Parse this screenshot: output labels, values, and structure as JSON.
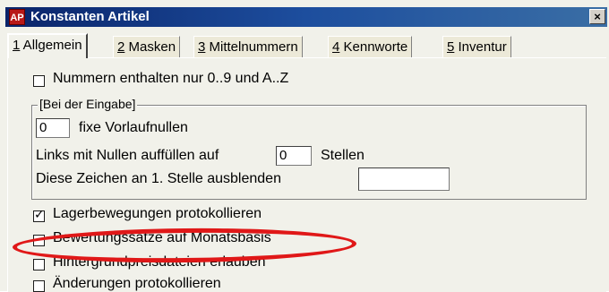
{
  "window": {
    "title": "Konstanten Artikel",
    "app_icon_glyph": "AP",
    "close_glyph": "×",
    "accent_color": "#0a246a"
  },
  "tabs": [
    {
      "key": "1",
      "rest": " Allgemein",
      "active": true
    },
    {
      "key": "2",
      "rest": " Masken",
      "active": false
    },
    {
      "key": "3",
      "rest": " Mittelnummern",
      "active": false
    },
    {
      "key": "4",
      "rest": " Kennworte",
      "active": false
    },
    {
      "key": "5",
      "rest": " Inventur",
      "active": false
    }
  ],
  "options": {
    "nummern_label": "Nummern enthalten nur 0..9 und A..Z",
    "nummern_checked": false,
    "lager_label": "Lagerbewegungen protokollieren",
    "lager_checked": true,
    "bewertung_label": "Bewertungssätze auf Monatsbasis",
    "bewertung_checked": false,
    "hintergrund_label": "Hintergrundpreisdateien erlauben",
    "hintergrund_checked": false,
    "aenderungen_label": "Änderungen protokollieren",
    "aenderungen_checked": false
  },
  "eingabe_group": {
    "legend": "[Bei der Eingabe]",
    "vorlauf_value": "0",
    "vorlauf_label": "fixe Vorlaufnullen",
    "links_label_pre": "Links mit Nullen auffüllen auf",
    "links_value": "0",
    "links_label_post": "Stellen",
    "ausblenden_label": "Diese Zeichen an 1. Stelle ausblenden",
    "ausblenden_value": ""
  },
  "highlight": {
    "color": "#e01818"
  }
}
